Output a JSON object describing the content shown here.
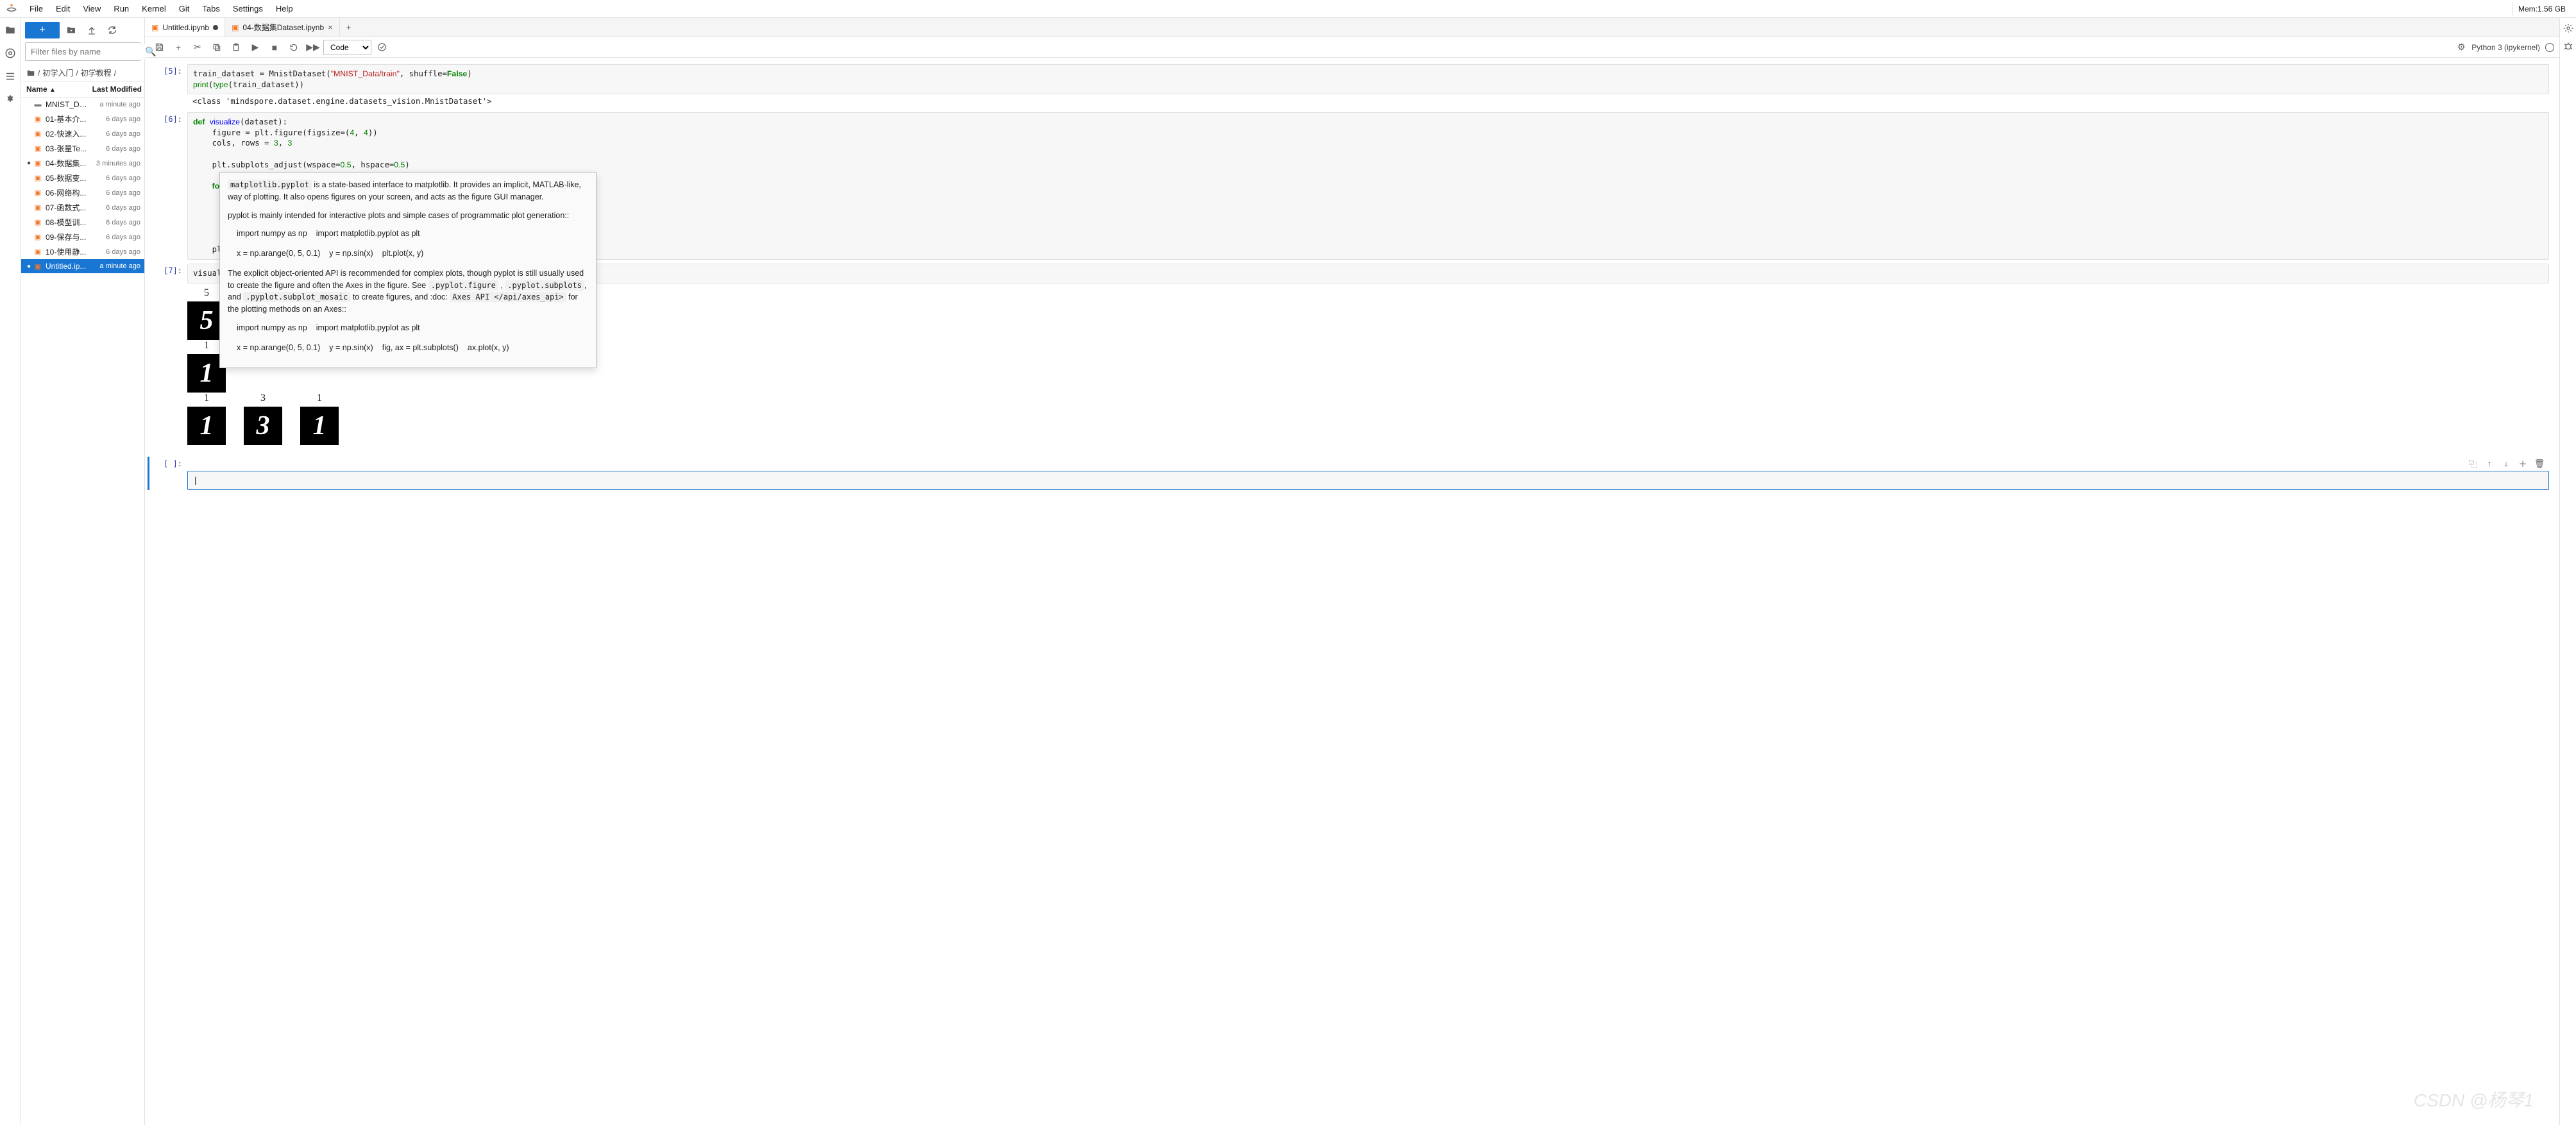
{
  "menubar": {
    "items": [
      "File",
      "Edit",
      "View",
      "Run",
      "Kernel",
      "Git",
      "Tabs",
      "Settings",
      "Help"
    ],
    "memory": "Mem:1.56 GB"
  },
  "left_panel": {
    "filter_placeholder": "Filter files by name",
    "breadcrumb": [
      "初学入门",
      "初学教程"
    ],
    "header_name": "Name",
    "header_modified": "Last Modified",
    "files": [
      {
        "type": "folder",
        "name": "MNIST_Data",
        "modified": "a minute ago",
        "dot": false
      },
      {
        "type": "nb",
        "name": "01-基本介...",
        "modified": "6 days ago",
        "dot": false
      },
      {
        "type": "nb",
        "name": "02-快速入...",
        "modified": "6 days ago",
        "dot": false
      },
      {
        "type": "nb",
        "name": "03-张量Te...",
        "modified": "6 days ago",
        "dot": false
      },
      {
        "type": "nb",
        "name": "04-数据集...",
        "modified": "3 minutes ago",
        "dot": true
      },
      {
        "type": "nb",
        "name": "05-数据变...",
        "modified": "6 days ago",
        "dot": false
      },
      {
        "type": "nb",
        "name": "06-网络构...",
        "modified": "6 days ago",
        "dot": false
      },
      {
        "type": "nb",
        "name": "07-函数式...",
        "modified": "6 days ago",
        "dot": false
      },
      {
        "type": "nb",
        "name": "08-模型训...",
        "modified": "6 days ago",
        "dot": false
      },
      {
        "type": "nb",
        "name": "09-保存与...",
        "modified": "6 days ago",
        "dot": false
      },
      {
        "type": "nb",
        "name": "10-使用静...",
        "modified": "6 days ago",
        "dot": false
      },
      {
        "type": "nb",
        "name": "Untitled.ip...",
        "modified": "a minute ago",
        "dot": true,
        "selected": true
      }
    ]
  },
  "tabs": [
    {
      "label": "Untitled.ipynb",
      "dirty": true,
      "active": true
    },
    {
      "label": "04-数据集Dataset.ipynb",
      "dirty": false,
      "active": false
    }
  ],
  "nb_toolbar": {
    "cell_type": "Code",
    "kernel": "Python 3 (ipykernel)"
  },
  "cells": {
    "c5_prompt": "[5]:",
    "c6_prompt": "[6]:",
    "c7_prompt": "[7]:",
    "cempty_prompt": "[ ]:",
    "c5_output": "<class 'mindspore.dataset.engine.datasets_vision.MnistDataset'>",
    "c7_call": "visualize("
  },
  "tooltip": {
    "title": "matplotlib.pyplot",
    "p1a": " is a state-based interface to matplotlib. It provides an implicit,  MATLAB-like, way of ",
    "p1b": "plotting.  It also opens figures on your screen, and acts as the figure GUI manager.",
    "p2": "pyplot is mainly intended for interactive plots and simple cases of programmatic plot generation::",
    "snip1a": "import numpy as np",
    "snip1b": "import matplotlib.pyplot as plt",
    "snip2a": "x = np.arange(0, 5, 0.1)",
    "snip2b": "y = np.sin(x)",
    "snip2c": "plt.plot(x, y)",
    "p3a": "The explicit object-oriented API is recommended for complex plots, though pyplot is still usually used to create the ",
    "p3b": "figure and often the Axes in the figure. See ",
    "code_fig": ".pyplot.figure",
    "code_sub": ".pyplot.subplots",
    "p3c": ", and ",
    "code_mos": ".pyplot.subplot_mosaic",
    "p3d": " to create figures, and :doc: ",
    "code_api": "Axes API </api/axes_api>",
    "p3e": " for the plotting ",
    "p3f": "methods on an Axes::",
    "snip3a": "import numpy as np",
    "snip3b": "import matplotlib.pyplot as plt",
    "snip4a": "x = np.arange(0, 5, 0.1)",
    "snip4b": "y = np.sin(x)",
    "snip4c": "fig, ax = plt.subplots()",
    "snip4d": "ax.plot(x, y)"
  },
  "chart_data": {
    "type": "table",
    "description": "3x3 grid of MNIST digit images with labels above each image (partially obscured by tooltip)",
    "rows": [
      {
        "labels": [
          "5"
        ],
        "digits": [
          "5"
        ]
      },
      {
        "labels": [
          "1"
        ],
        "digits": [
          "1"
        ]
      },
      {
        "labels": [
          "1",
          "3",
          "1"
        ],
        "digits": [
          "1",
          "3",
          "1"
        ]
      }
    ]
  },
  "watermark": "CSDN @杨琴1"
}
